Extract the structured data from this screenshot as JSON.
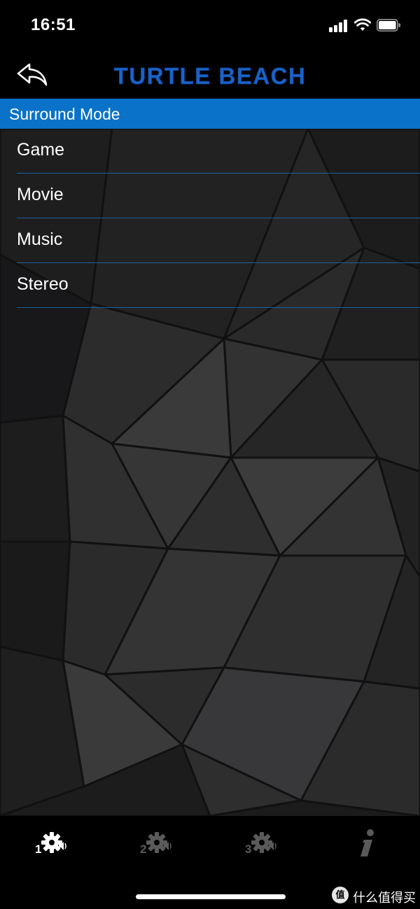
{
  "status_bar": {
    "time": "16:51"
  },
  "header": {
    "logo_text": "TURTLE BEACH"
  },
  "section": {
    "title": "Surround Mode"
  },
  "modes": [
    {
      "label": "Game"
    },
    {
      "label": "Movie"
    },
    {
      "label": "Music"
    },
    {
      "label": "Stereo"
    }
  ],
  "tabs": [
    {
      "number": "1",
      "icon": "gear-speaker-icon",
      "active": true
    },
    {
      "number": "2",
      "icon": "gear-speaker-icon",
      "active": false
    },
    {
      "number": "3",
      "icon": "gear-speaker-icon",
      "active": false
    },
    {
      "icon": "info-icon",
      "active": false
    }
  ],
  "watermark": {
    "badge": "值",
    "text": "什么值得买"
  },
  "colors": {
    "accent_blue": "#0a72c8",
    "divider_blue": "#1d5f9e",
    "logo_blue": "#1a63c9",
    "tab_active": "#ffffff",
    "tab_inactive": "#5a5a5a"
  }
}
